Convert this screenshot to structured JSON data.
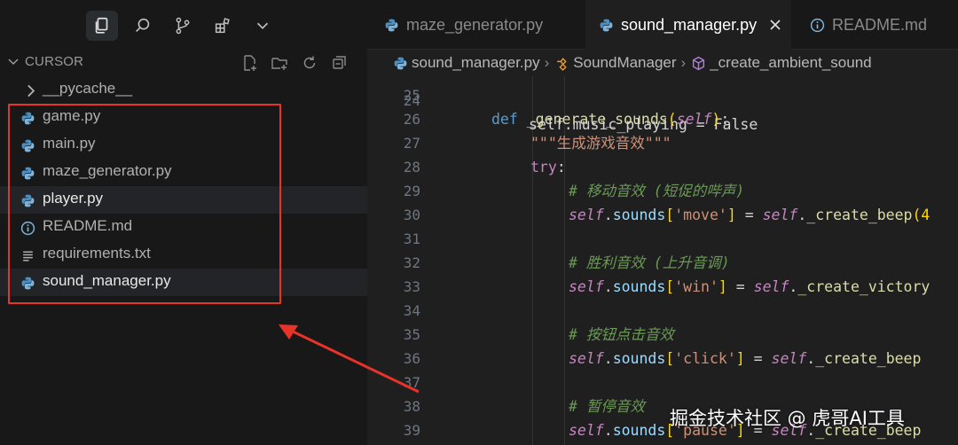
{
  "sidebar": {
    "explorer_title": "CURSOR",
    "activity_icons": [
      "explorer-icon",
      "search-icon",
      "source-control-icon",
      "extensions-icon",
      "chevron-down-icon"
    ],
    "header_actions": [
      "new-file-icon",
      "new-folder-icon",
      "refresh-icon",
      "collapse-all-icon"
    ],
    "tree": [
      {
        "label": "__pycache__",
        "type": "folder"
      },
      {
        "label": "game.py",
        "type": "python"
      },
      {
        "label": "main.py",
        "type": "python"
      },
      {
        "label": "maze_generator.py",
        "type": "python"
      },
      {
        "label": "player.py",
        "type": "python"
      },
      {
        "label": "README.md",
        "type": "info"
      },
      {
        "label": "requirements.txt",
        "type": "text"
      },
      {
        "label": "sound_manager.py",
        "type": "python"
      }
    ]
  },
  "tabs": [
    {
      "label": "maze_generator.py",
      "active": false
    },
    {
      "label": "sound_manager.py",
      "active": true
    },
    {
      "label": "README.md",
      "active": false
    }
  ],
  "breadcrumb": {
    "file": "sound_manager.py",
    "class": "SoundManager",
    "method": "_create_ambient_sound"
  },
  "code": {
    "lines": [
      {
        "n": "24",
        "top_text": "self.music_playing = False"
      },
      {
        "n": "25"
      },
      {
        "n": "26",
        "def": "def",
        "name": "_generate_sounds",
        "param": "self"
      },
      {
        "n": "27",
        "doc": "\"\"\"生成游戏音效\"\"\""
      },
      {
        "n": "28",
        "try": "try"
      },
      {
        "n": "29",
        "comment": "# 移动音效 (短促的哔声)"
      },
      {
        "n": "30",
        "key": "'move'",
        "call": "_create_beep",
        "tail": "(4"
      },
      {
        "n": "31"
      },
      {
        "n": "32",
        "comment": "# 胜利音效 (上升音调)"
      },
      {
        "n": "33",
        "key": "'win'",
        "call": "_create_victory",
        "tail": ""
      },
      {
        "n": "34"
      },
      {
        "n": "35",
        "comment": "# 按钮点击音效"
      },
      {
        "n": "36",
        "key": "'click'",
        "call": "_create_beep",
        "tail": ""
      },
      {
        "n": "37"
      },
      {
        "n": "38",
        "comment": "# 暂停音效"
      },
      {
        "n": "39",
        "key": "'pause'",
        "call": "_create_beep",
        "tail": ""
      }
    ],
    "self_kw": "self",
    "sounds_attr": "sounds"
  },
  "watermark": "掘金技术社区 @ 虎哥AI工具",
  "colors": {
    "highlight": "#e8332a",
    "python_icon": "#4a90c2",
    "keyword": "#569cd6",
    "function": "#dcdcaa",
    "string": "#ce9178",
    "comment": "#6a9955"
  }
}
